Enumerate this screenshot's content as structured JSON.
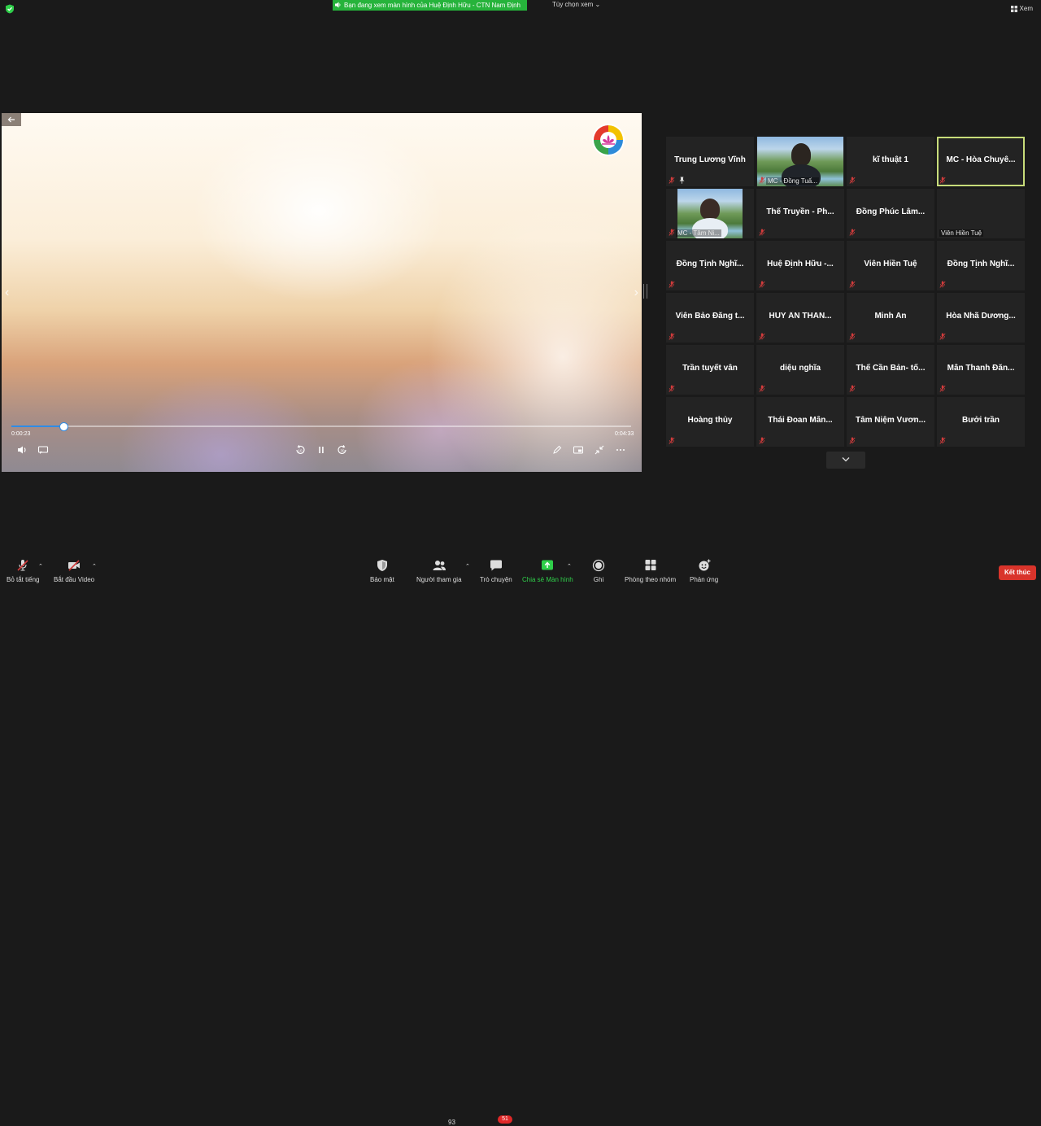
{
  "top_bar": {
    "share_banner": "Bạn đang xem màn hình của Huệ Định Hữu - CTN Nam Định",
    "view_options": "Tùy chọn xem ⌄",
    "view_button": "Xem"
  },
  "video": {
    "elapsed": "0:00:23",
    "duration": "0:04:33",
    "progress": 0.084
  },
  "gallery": {
    "tiles": [
      {
        "name": "Trung Lương Vĩnh",
        "muted": true,
        "pinned": true
      },
      {
        "name": "",
        "label": "MC - Đồng Tuấ...",
        "video": true,
        "muted": true
      },
      {
        "name": "kĩ thuật 1",
        "muted": true
      },
      {
        "name": "MC - Hòa Chuyê...",
        "muted": true,
        "active": true
      },
      {
        "name": "",
        "label": "MC - Tâm Ni...",
        "video": true,
        "muted": true
      },
      {
        "name": "Thế Truyền - Ph...",
        "muted": true
      },
      {
        "name": "Đồng Phúc Lâm...",
        "muted": true
      },
      {
        "name": "",
        "label": "Viên Hiền Tuệ"
      },
      {
        "name": "Đồng Tịnh Nghĩ...",
        "muted": true
      },
      {
        "name": "Huệ Định Hữu -...",
        "muted": true
      },
      {
        "name": "Viên Hiền Tuệ",
        "muted": true
      },
      {
        "name": "Đồng Tịnh Nghĩ...",
        "muted": true
      },
      {
        "name": "Viên Bảo Đăng t...",
        "muted": true
      },
      {
        "name": "HUY ÂN THAN...",
        "muted": true
      },
      {
        "name": "Minh An",
        "muted": true
      },
      {
        "name": "Hòa Nhã Dương...",
        "muted": true
      },
      {
        "name": "Trần tuyết vân",
        "muted": true
      },
      {
        "name": "diệu nghĩa",
        "muted": true
      },
      {
        "name": "Thế Cần Bản- tổ...",
        "muted": true
      },
      {
        "name": "Mẫn Thanh Đăn...",
        "muted": true
      },
      {
        "name": "Hoàng thủy",
        "muted": true
      },
      {
        "name": "Thái Đoan Mẫn...",
        "muted": true
      },
      {
        "name": "Tâm Niệm Vươn...",
        "muted": true
      },
      {
        "name": "Bưởi trần",
        "muted": true
      }
    ]
  },
  "toolbar": {
    "mute_all": "Bỏ tắt tiếng",
    "start_video": "Bắt đầu Video",
    "security": "Bảo mật",
    "participants": "Người tham gia",
    "participants_count": "93",
    "chat": "Trò chuyện",
    "chat_badge": "51",
    "share_screen": "Chia sẻ Màn hình",
    "record": "Ghi",
    "breakout": "Phòng theo nhóm",
    "reactions": "Phản ứng",
    "end": "Kết thúc"
  },
  "colors": {
    "banner_green": "#26b33b",
    "share_green": "#2fcf4a",
    "end_red": "#d9342b",
    "mute_red": "#d23c3c",
    "active_speaker": "#c7dc7a",
    "progress_blue": "#2f8ce6"
  }
}
